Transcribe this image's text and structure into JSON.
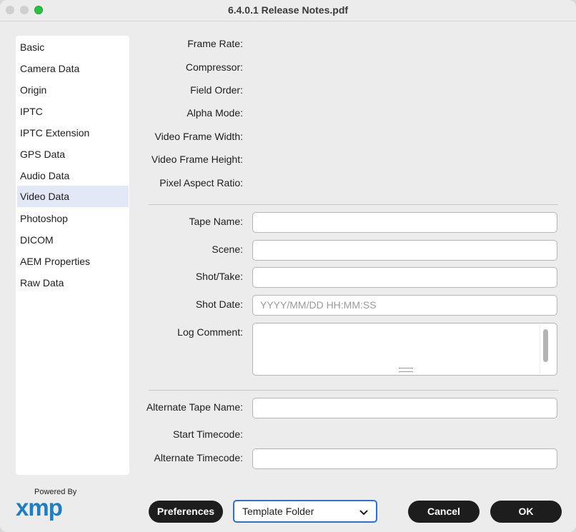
{
  "window": {
    "title": "6.4.0.1 Release Notes.pdf"
  },
  "sidebar": {
    "items": [
      {
        "label": "Basic",
        "selected": false
      },
      {
        "label": "Camera Data",
        "selected": false
      },
      {
        "label": "Origin",
        "selected": false
      },
      {
        "label": "IPTC",
        "selected": false
      },
      {
        "label": "IPTC Extension",
        "selected": false
      },
      {
        "label": "GPS Data",
        "selected": false
      },
      {
        "label": "Audio Data",
        "selected": false
      },
      {
        "label": "Video Data",
        "selected": true
      },
      {
        "label": "Photoshop",
        "selected": false
      },
      {
        "label": "DICOM",
        "selected": false
      },
      {
        "label": "AEM Properties",
        "selected": false
      },
      {
        "label": "Raw Data",
        "selected": false
      }
    ]
  },
  "readonly": {
    "frame_rate": "Frame Rate:",
    "compressor": "Compressor:",
    "field_order": "Field Order:",
    "alpha_mode": "Alpha Mode:",
    "video_frame_width": "Video Frame Width:",
    "video_frame_height": "Video Frame Height:",
    "pixel_aspect_ratio": "Pixel Aspect Ratio:"
  },
  "fields": {
    "tape_name": {
      "label": "Tape Name:",
      "value": ""
    },
    "scene": {
      "label": "Scene:",
      "value": ""
    },
    "shot_take": {
      "label": "Shot/Take:",
      "value": ""
    },
    "shot_date": {
      "label": "Shot Date:",
      "placeholder": "YYYY/MM/DD HH:MM:SS"
    },
    "log_comment": {
      "label": "Log Comment:",
      "value": ""
    },
    "alternate_tape_name": {
      "label": "Alternate Tape Name:",
      "value": ""
    },
    "start_timecode": {
      "label": "Start Timecode:"
    },
    "alternate_timecode": {
      "label": "Alternate Timecode:",
      "value": ""
    }
  },
  "logo": {
    "powered_by": "Powered By",
    "brand": "xmp"
  },
  "footer": {
    "preferences": "Preferences",
    "template_folder": "Template Folder",
    "cancel": "Cancel",
    "ok": "OK"
  },
  "colors": {
    "accent": "#2a6fd6",
    "selected_row": "#e2e8f5",
    "button": "#1d1d1d",
    "xmp_blue": "#1f7ec1"
  }
}
